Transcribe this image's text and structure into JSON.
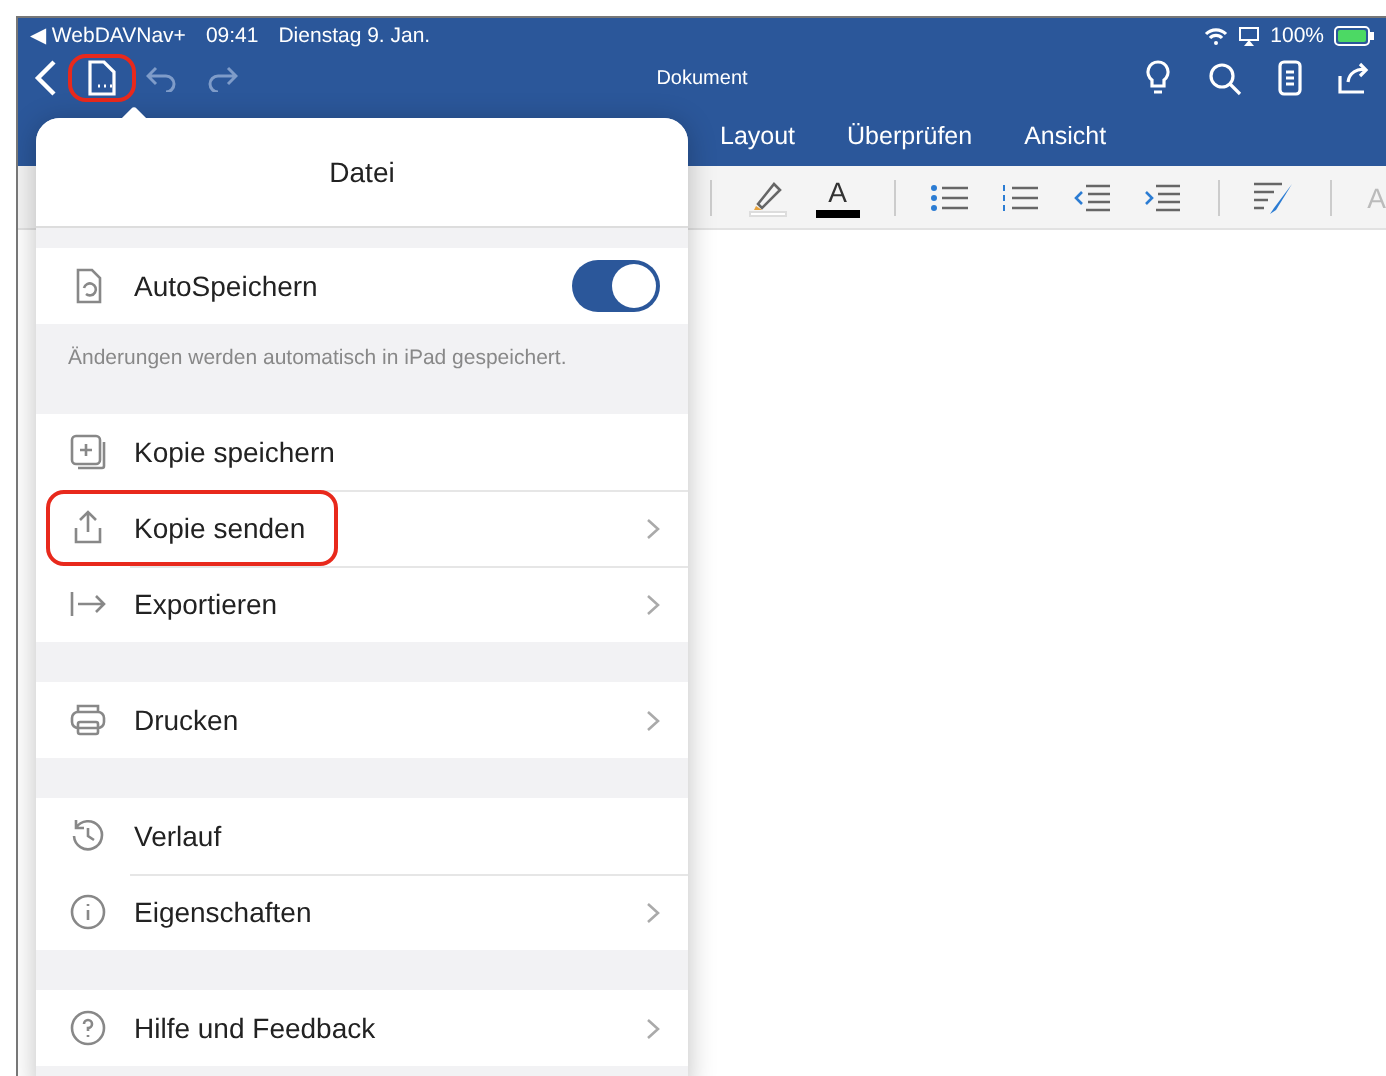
{
  "status_bar": {
    "back_glyph": "◀",
    "back_app": "WebDAVNav+",
    "time": "09:41",
    "date": "Dienstag 9. Jan.",
    "battery": "100%"
  },
  "toolbar": {
    "title": "Dokument",
    "file_button_highlighted": true
  },
  "tabs": [
    {
      "label": "Layout",
      "selected": false
    },
    {
      "label": "Überprüfen",
      "selected": false
    },
    {
      "label": "Ansicht",
      "selected": false
    }
  ],
  "ribbon": {
    "font_color_glyph": "A",
    "cut_glyph": "A"
  },
  "file_menu": {
    "title": "Datei",
    "sections": [
      {
        "items": [
          {
            "kind": "toggle",
            "label": "AutoSpeichern",
            "on": true
          }
        ],
        "note": "Änderungen werden automatisch in iPad gespeichert."
      },
      {
        "items": [
          {
            "kind": "link",
            "label": "Kopie speichern",
            "chevron": false,
            "highlighted": false
          },
          {
            "kind": "link",
            "label": "Kopie senden",
            "chevron": true,
            "highlighted": true
          },
          {
            "kind": "link",
            "label": "Exportieren",
            "chevron": true,
            "highlighted": false
          }
        ]
      },
      {
        "items": [
          {
            "kind": "link",
            "label": "Drucken",
            "chevron": true,
            "highlighted": false
          }
        ]
      },
      {
        "items": [
          {
            "kind": "link",
            "label": "Verlauf",
            "chevron": false,
            "highlighted": false
          },
          {
            "kind": "link",
            "label": "Eigenschaften",
            "chevron": true,
            "highlighted": false
          }
        ]
      },
      {
        "items": [
          {
            "kind": "link",
            "label": "Hilfe und Feedback",
            "chevron": true,
            "highlighted": false
          }
        ]
      }
    ]
  }
}
